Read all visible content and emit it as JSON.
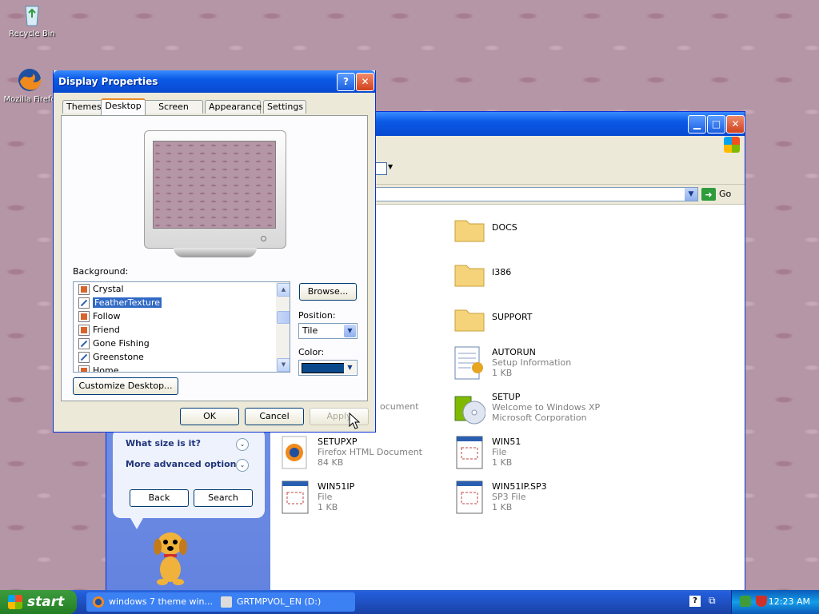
{
  "desktop": {
    "icons": [
      {
        "label": "Recycle Bin"
      },
      {
        "label": "Mozilla Firefo"
      }
    ]
  },
  "explorer": {
    "addressbar": {
      "go_label": "Go"
    },
    "left_pane": {
      "options": [
        "What size is it?",
        "More advanced options"
      ],
      "back_label": "Back",
      "search_label": "Search"
    },
    "files": [
      {
        "name": "DOCS",
        "type": "folder"
      },
      {
        "name": "I386",
        "type": "folder"
      },
      {
        "name": "SUPPORT",
        "type": "folder"
      },
      {
        "name": "AUTORUN",
        "line1": "Setup Information",
        "line2": "1 KB"
      },
      {
        "name": "SETUP",
        "line1": "Welcome to Windows XP",
        "line2": "Microsoft Corporation"
      },
      {
        "name": "SETUPXP",
        "line1": "Firefox HTML Document",
        "line2": "84 KB"
      },
      {
        "name": "WIN51",
        "line1": "File",
        "line2": "1 KB"
      },
      {
        "name": "WIN51IP",
        "line1": "File",
        "line2": "1 KB"
      },
      {
        "name": "WIN51IP.SP3",
        "line1": "SP3 File",
        "line2": "1 KB"
      }
    ],
    "partial_text": "ocument"
  },
  "dialog": {
    "title": "Display Properties",
    "help_label": "?",
    "close_label": "✕",
    "tabs": [
      "Themes",
      "Desktop",
      "Screen Saver",
      "Appearance",
      "Settings"
    ],
    "background_label": "Background:",
    "backgrounds": [
      {
        "name": "Crystal",
        "icon": "wall"
      },
      {
        "name": "FeatherTexture",
        "icon": "draw",
        "selected": true
      },
      {
        "name": "Follow",
        "icon": "wall"
      },
      {
        "name": "Friend",
        "icon": "wall"
      },
      {
        "name": "Gone Fishing",
        "icon": "draw"
      },
      {
        "name": "Greenstone",
        "icon": "draw"
      },
      {
        "name": "Home",
        "icon": "wall"
      }
    ],
    "browse_label": "Browse...",
    "position_label": "Position:",
    "position_value": "Tile",
    "color_label": "Color:",
    "color_value": "#0a4a8c",
    "customize_label": "Customize Desktop...",
    "ok_label": "OK",
    "cancel_label": "Cancel",
    "apply_label": "Apply"
  },
  "taskbar": {
    "start_label": "start",
    "tasks": [
      {
        "label": "windows 7 theme win..."
      },
      {
        "label": "GRTMPVOL_EN (D:)"
      }
    ],
    "clock": "12:23 AM"
  }
}
